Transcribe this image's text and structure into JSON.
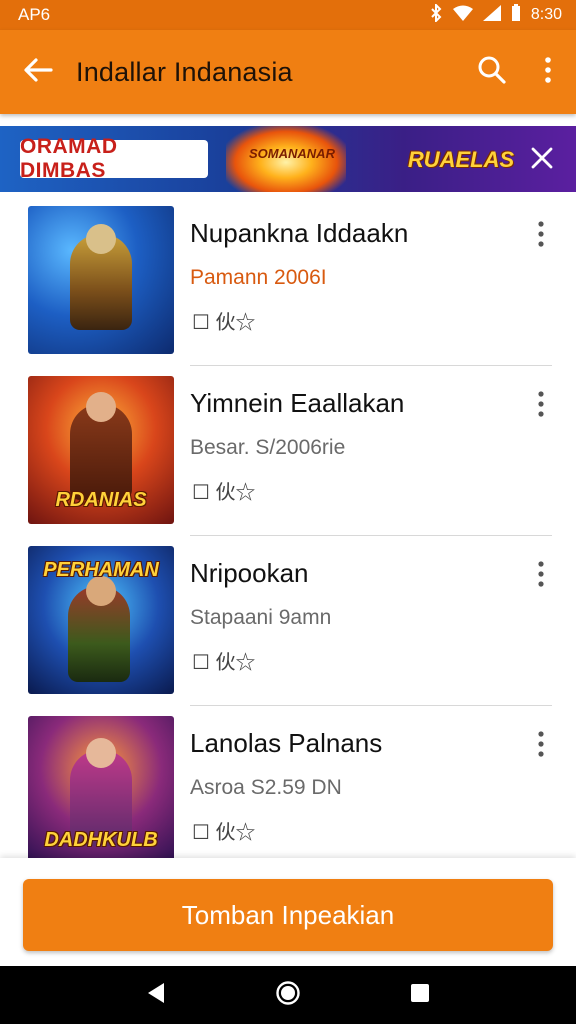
{
  "status_bar": {
    "left_text": "AP6",
    "time": "8:30"
  },
  "app_bar": {
    "title": "Indallar Indanasia",
    "back_icon": "arrow-left-icon",
    "search_icon": "search-icon",
    "menu_icon": "more-vertical-icon"
  },
  "ad": {
    "left_text": "ORAMAD DIMBAS",
    "center_text": "SOMANANAR",
    "right_text": "RUAELAS",
    "colors": {
      "bg_start": "#1e63c4",
      "bg_end": "#5b1fa0"
    }
  },
  "items": [
    {
      "title": "Nupankna Iddaakn",
      "subtitle": "Pamann 2006I",
      "subtitle_accent": true,
      "icons": "☐ 伙☆",
      "thumb_label": ""
    },
    {
      "title": "Yimnein Eaallakan",
      "subtitle": "Besar. S/2006rie",
      "subtitle_accent": false,
      "icons": "☐ 伙☆",
      "thumb_label": "RDANIAS"
    },
    {
      "title": "Nripookan",
      "subtitle": "Stapaani 9amn",
      "subtitle_accent": false,
      "icons": "☐ 伙☆",
      "thumb_label": "PERHAMAN"
    },
    {
      "title": "Lanolas Palnans",
      "subtitle": "Asroa S2.59 DN",
      "subtitle_accent": false,
      "icons": "☐ 伙☆",
      "thumb_label": "DADHKULB"
    }
  ],
  "cta": {
    "label": "Tomban Inpeakian"
  },
  "colors": {
    "accent": "#f07f12",
    "status_bar": "#e36f0b"
  }
}
